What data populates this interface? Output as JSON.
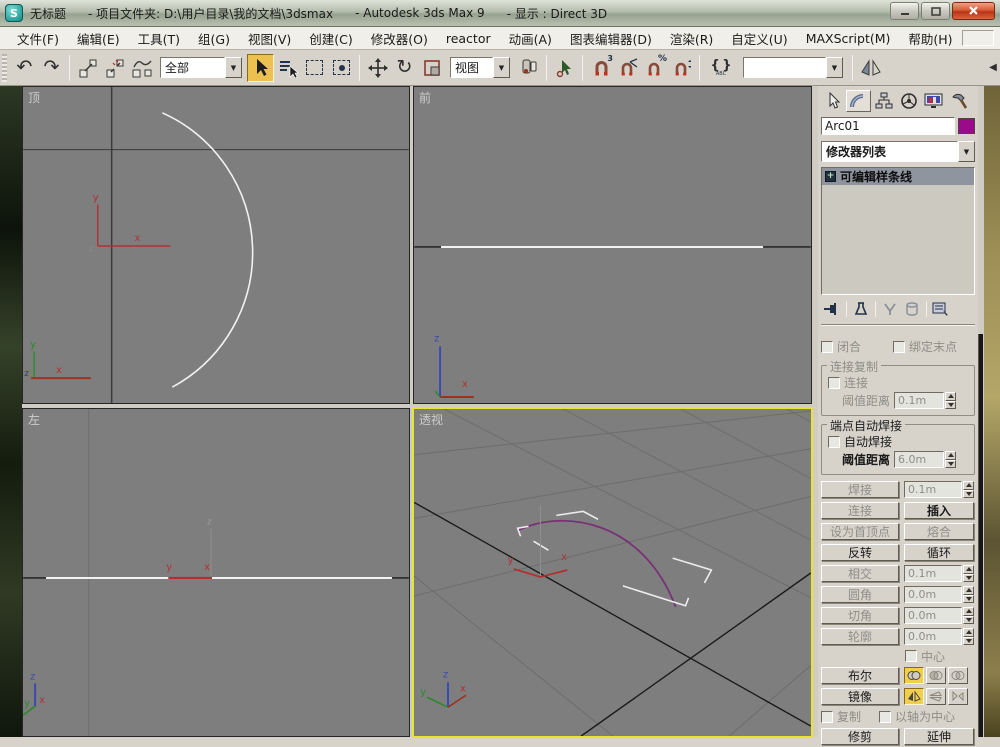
{
  "window": {
    "title_doc": "无标题",
    "title_project": "- 项目文件夹: D:\\用户目录\\我的文档\\3dsmax",
    "title_app": "- Autodesk 3ds Max 9",
    "title_display": "- 显示 : Direct 3D"
  },
  "menu": {
    "items": [
      "文件(F)",
      "编辑(E)",
      "工具(T)",
      "组(G)",
      "视图(V)",
      "创建(C)",
      "修改器(O)",
      "reactor",
      "动画(A)",
      "图表编辑器(D)",
      "渲染(R)",
      "自定义(U)",
      "MAXScript(M)",
      "帮助(H)"
    ]
  },
  "toolbar": {
    "filter_value": "全部",
    "coord_value": "视图",
    "named_selection_value": "",
    "icons": [
      "undo-icon",
      "redo-icon",
      "select-and-link-icon",
      "unlink-selection-icon",
      "bind-to-space-warp-icon",
      "select-object-icon",
      "select-by-name-icon",
      "rectangular-selection-region-icon",
      "window-crossing-icon",
      "select-and-move-icon",
      "select-and-rotate-icon",
      "select-and-scale-icon",
      "use-pivot-point-center-icon",
      "select-and-manipulate-icon",
      "snaps-toggle-3d-icon",
      "angle-snap-icon",
      "percent-snap-icon",
      "spinner-snap-icon",
      "named-selection-sets-icon",
      "mirror-icon"
    ]
  },
  "viewports": {
    "top_label": "顶",
    "front_label": "前",
    "left_label": "左",
    "persp_label": "透视",
    "active_border_color": "#e7e234",
    "background_color": "#7e7e7e",
    "spline_color": "#7a3076"
  },
  "panel": {
    "tab_icons": [
      "create-tab-icon",
      "modify-tab-icon",
      "hierarchy-tab-icon",
      "motion-tab-icon",
      "display-tab-icon",
      "utilities-tab-icon"
    ],
    "object_name": "Arc01",
    "object_color": "#9c0a8c",
    "modifier_list_label": "修改器列表",
    "stack_item": "可编辑样条线",
    "stack_tool_icons": [
      "pin-stack-icon",
      "show-end-result-icon",
      "make-unique-icon",
      "remove-modifier-icon",
      "configure-modifier-sets-icon"
    ],
    "rollout": {
      "close_label": "闭合",
      "bind_last_label": "绑定末点",
      "connect_copy_group": "连接复制",
      "connect_check_label": "连接",
      "threshold_label": "阈值距离",
      "connect_threshold_value": "0.1m",
      "auto_weld_group": "端点自动焊接",
      "auto_weld_label": "自动焊接",
      "auto_weld_threshold_value": "6.0m",
      "weld": "焊接",
      "weld_value": "0.1m",
      "connect_btn": "连接",
      "insert": "插入",
      "make_first": "设为首顶点",
      "fuse": "熔合",
      "reverse": "反转",
      "cycle": "循环",
      "cross_insert": "相交",
      "cross_value": "0.1m",
      "fillet": "圆角",
      "fillet_value": "0.0m",
      "chamfer": "切角",
      "chamfer_value": "0.0m",
      "outline": "轮廓",
      "outline_value": "0.0m",
      "center": "中心",
      "boolean": "布尔",
      "mirror": "镜像",
      "copy": "复制",
      "about_pivot": "以轴为中心",
      "trim": "修剪",
      "extend": "延伸"
    }
  }
}
